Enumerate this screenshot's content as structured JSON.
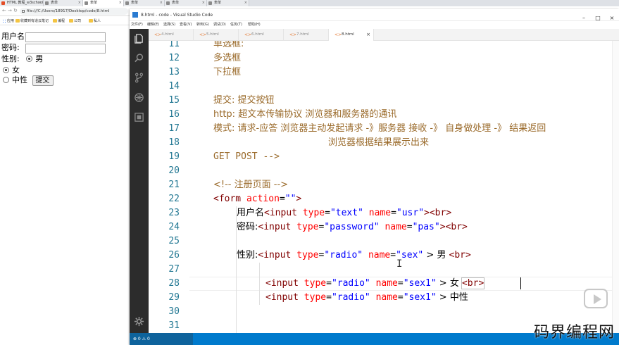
{
  "browser": {
    "tabs": [
      {
        "label": "HTML 教程_w3school",
        "icon": "html5-favicon"
      },
      {
        "label": "表单",
        "icon": "document-favicon"
      },
      {
        "label": "表单",
        "icon": "document-favicon"
      },
      {
        "label": "表单",
        "icon": "document-favicon"
      },
      {
        "label": "表单",
        "icon": "document-favicon"
      },
      {
        "label": "表单",
        "icon": "document-favicon"
      }
    ],
    "address": "file:///C:/Users/18917/Desktop/code/8.html",
    "bookmarks": [
      "应用",
      "收藏到有道云笔记",
      "编程",
      "公司",
      "私人"
    ],
    "form": {
      "username_label": "用户名",
      "password_label": "密码:",
      "gender_label": "性别:",
      "male": "男",
      "female": "女",
      "neutral": "中性",
      "submit": "提交"
    }
  },
  "vscode": {
    "title": "8.html - code - Visual Studio Code",
    "menu": [
      "文件(F)",
      "编辑(E)",
      "选择(S)",
      "查看(V)",
      "转到(G)",
      "调试(D)",
      "任务(T)",
      "帮助(H)"
    ],
    "tabs": [
      "4.html",
      "5.html",
      "6.html",
      "7.html",
      "8.html"
    ],
    "active_tab": "8.html",
    "line_numbers": [
      "11",
      "12",
      "13",
      "14",
      "15",
      "16",
      "17",
      "18",
      "19",
      "20",
      "21",
      "22",
      "23",
      "24",
      "25",
      "26",
      "27",
      "28",
      "29",
      "30",
      "31"
    ],
    "lines": {
      "l11": "单选框:",
      "l12": "多选框",
      "l13": "下拉框",
      "l15": "提交: 提交按钮",
      "l16": "http: 超文本传输协议 浏览器和服务器的通讯",
      "l17": "模式: 请求-应答 浏览器主动发起请求 -》服务器 接收  -》 自身做处理 -》 结果返回",
      "l18": "浏览器根据结果展示出来",
      "l19": "GET  POST -->",
      "l21": "<!-- 注册页面 -->",
      "l22_tag": "<form",
      "l22_attr": "action",
      "l22_str": "\"\"",
      "l22_end": ">",
      "l23_text": "用户名",
      "l23_tag": "<input",
      "l23_a1": "type",
      "l23_v1": "\"text\"",
      "l23_a2": "name",
      "l23_v2": "\"usr\"",
      "l23_end": "><br>",
      "l24_text": "密码:",
      "l24_tag": "<input",
      "l24_a1": "type",
      "l24_v1": "\"password\"",
      "l24_a2": "name",
      "l24_v2": "\"pas\"",
      "l24_end": "><br>",
      "l26_text": "性别:",
      "l26_tag": "<input",
      "l26_a1": "type",
      "l26_v1": "\"radio\"",
      "l26_a2": "name",
      "l26_v2": "\"sex\"",
      "l26_after": " > 男 ",
      "l26_br": "<br>",
      "l28_tag": "<input",
      "l28_a1": "type",
      "l28_v1": "\"radio\"",
      "l28_a2": "name",
      "l28_v2": "\"sex1\"",
      "l28_after": " > 女 ",
      "l28_br": "<br>",
      "l29_tag": "<input",
      "l29_a1": "type",
      "l29_v1": "\"radio\"",
      "l29_a2": "name",
      "l29_v2": "\"sex1\"",
      "l29_after": " > 中性"
    },
    "status": "⊗ 0 ⚠ 0"
  },
  "watermark": "码界编程网",
  "colors": {
    "activity_bar": "#2c2c2c",
    "status_bar": "#007acc",
    "tag": "#800000",
    "attr": "#ff0000",
    "string": "#0000ff",
    "comment_text": "#9a6a2a",
    "line_number": "#237893"
  }
}
